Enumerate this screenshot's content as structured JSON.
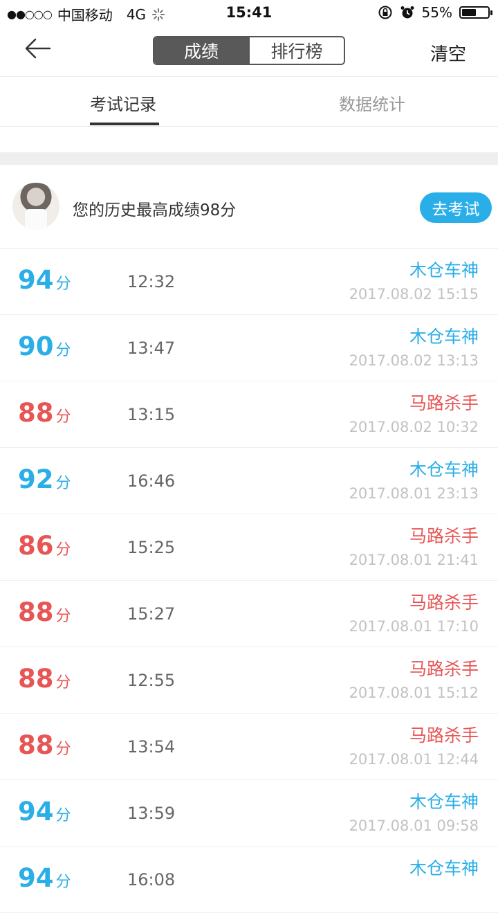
{
  "status_bar": {
    "signal": "●●○○○",
    "carrier": "中国移动",
    "network": "4G",
    "time": "15:41",
    "battery_percent": "55%",
    "battery_level": 0.55,
    "icons": [
      "loading-icon",
      "rotation-lock-icon",
      "alarm-icon",
      "battery-icon"
    ]
  },
  "nav": {
    "back_icon": "back-arrow-icon",
    "segments": [
      "成绩",
      "排行榜"
    ],
    "clear_label": "清空"
  },
  "tabs": [
    "考试记录",
    "数据统计"
  ],
  "profile": {
    "best_text": "您的历史最高成绩98分",
    "go_button": "去考试"
  },
  "colors": {
    "accent": "#2aaee8",
    "fail": "#e85555"
  },
  "unit": "分",
  "records": [
    {
      "score": "94",
      "duration": "12:32",
      "title": "木仓车神",
      "date": "2017.08.02 15:15",
      "color": "blue"
    },
    {
      "score": "90",
      "duration": "13:47",
      "title": "木仓车神",
      "date": "2017.08.02 13:13",
      "color": "blue"
    },
    {
      "score": "88",
      "duration": "13:15",
      "title": "马路杀手",
      "date": "2017.08.02 10:32",
      "color": "red"
    },
    {
      "score": "92",
      "duration": "16:46",
      "title": "木仓车神",
      "date": "2017.08.01 23:13",
      "color": "blue"
    },
    {
      "score": "86",
      "duration": "15:25",
      "title": "马路杀手",
      "date": "2017.08.01 21:41",
      "color": "red"
    },
    {
      "score": "88",
      "duration": "15:27",
      "title": "马路杀手",
      "date": "2017.08.01 17:10",
      "color": "red"
    },
    {
      "score": "88",
      "duration": "12:55",
      "title": "马路杀手",
      "date": "2017.08.01 15:12",
      "color": "red"
    },
    {
      "score": "88",
      "duration": "13:54",
      "title": "马路杀手",
      "date": "2017.08.01 12:44",
      "color": "red"
    },
    {
      "score": "94",
      "duration": "13:59",
      "title": "木仓车神",
      "date": "2017.08.01 09:58",
      "color": "blue"
    },
    {
      "score": "94",
      "duration": "16:08",
      "title": "木仓车神",
      "date": "",
      "color": "blue"
    }
  ]
}
